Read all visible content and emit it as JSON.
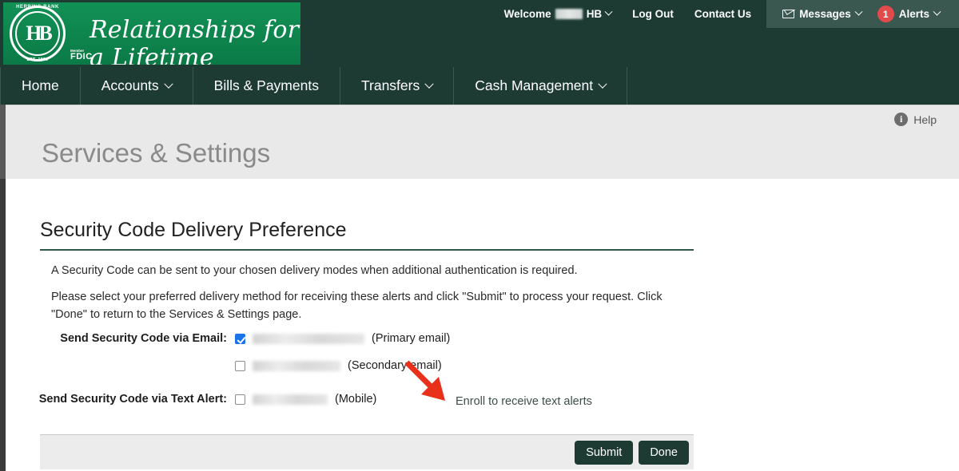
{
  "brand": {
    "seal_top_text": "HERRING BANK",
    "seal_monogram": "HB",
    "seal_bottom_text": "EST. 1899",
    "fdic_small": "Member",
    "fdic_label": "FDIC",
    "tagline": "Relationships for a Lifetime",
    "banner_color": "#0f8a52",
    "header_color": "#1e3b33"
  },
  "utility": {
    "welcome_label": "Welcome",
    "welcome_suffix": "HB",
    "log_out": "Log Out",
    "contact_us": "Contact Us",
    "messages": "Messages",
    "alerts": "Alerts",
    "alerts_count": "1",
    "alerts_badge_color": "#e14b4b",
    "messages_panel_color": "#3a5750"
  },
  "nav": {
    "items": [
      {
        "label": "Home",
        "has_caret": false
      },
      {
        "label": "Accounts",
        "has_caret": true
      },
      {
        "label": "Bills & Payments",
        "has_caret": false
      },
      {
        "label": "Transfers",
        "has_caret": true
      },
      {
        "label": "Cash Management",
        "has_caret": true
      }
    ]
  },
  "titlebar": {
    "help": "Help",
    "info_glyph": "i",
    "page_title": "Services & Settings"
  },
  "main": {
    "section_heading": "Security Code Delivery Preference",
    "paragraph_1": "A Security Code can be sent to your chosen delivery modes when additional authentication is required.",
    "paragraph_2": "Please select your preferred delivery method for receiving these alerts and click \"Submit\" to process your request. Click \"Done\" to return to the Services & Settings page.",
    "rows": [
      {
        "label": "Send Security Code via Email:",
        "checked": true,
        "value_redacted": true,
        "value_width": 140,
        "suffix": "(Primary email)"
      },
      {
        "label": "",
        "checked": false,
        "value_redacted": true,
        "value_width": 110,
        "suffix": "(Secondary email)"
      },
      {
        "label": "Send Security Code via Text Alert:",
        "checked": false,
        "value_redacted": true,
        "value_width": 94,
        "suffix": "(Mobile)"
      }
    ],
    "enroll_link": "Enroll to receive text alerts",
    "annotation_arrow_color": "#e8301a"
  },
  "actions": {
    "submit_label": "Submit",
    "done_label": "Done",
    "button_color": "#1e3b33"
  }
}
